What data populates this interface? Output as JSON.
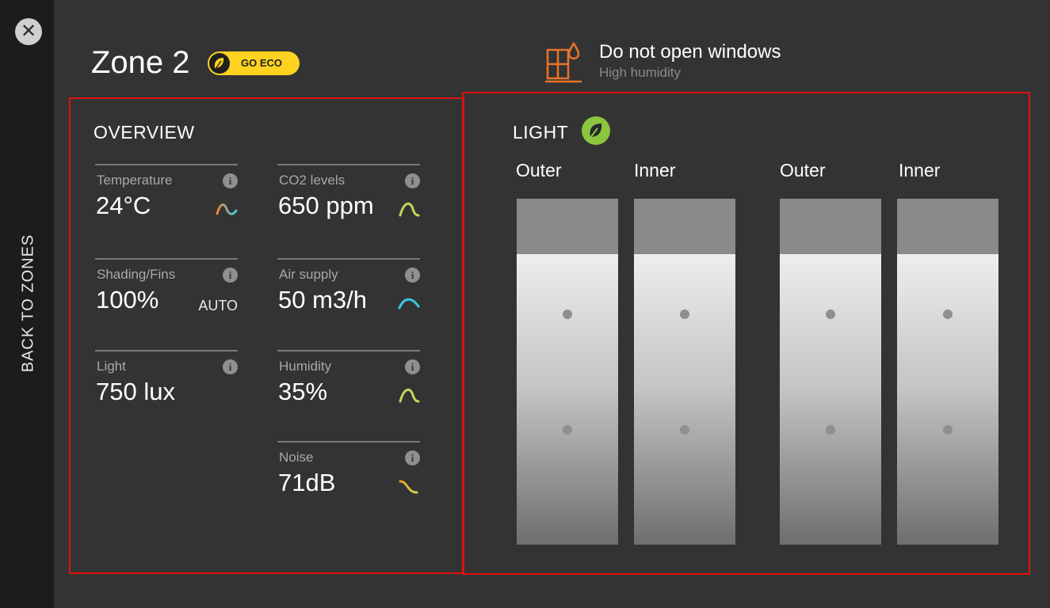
{
  "nav": {
    "back_label": "BACK TO ZONES",
    "close_glyph": "✕"
  },
  "zone": {
    "title": "Zone 2",
    "eco_button_label": "GO ECO"
  },
  "alert": {
    "title": "Do not open windows",
    "subtitle": "High humidity"
  },
  "colors": {
    "accent_yellow": "#ffd21f",
    "eco_green": "#8cc63f",
    "alert_orange": "#e8742a",
    "panel_border": "#e01010"
  },
  "overview": {
    "title": "OVERVIEW",
    "metrics": [
      {
        "label": "Temperature",
        "value": "24°C",
        "trend_icon": "temperature-trend-icon"
      },
      {
        "label": "CO2 levels",
        "value": "650 ppm",
        "trend_icon": "co2-trend-icon"
      },
      {
        "label": "Shading/Fins",
        "value": "100%",
        "mode": "AUTO"
      },
      {
        "label": "Air supply",
        "value": "50 m3/h",
        "trend_icon": "air-trend-icon"
      },
      {
        "label": "Light",
        "value": "750 lux"
      },
      {
        "label": "Humidity",
        "value": "35%",
        "trend_icon": "humidity-trend-icon"
      },
      {
        "label": "Noise",
        "value": "71dB",
        "trend_icon": "noise-trend-icon"
      }
    ]
  },
  "light": {
    "title": "LIGHT",
    "columns": [
      {
        "label": "Outer",
        "shade_fraction": 0.16
      },
      {
        "label": "Inner",
        "shade_fraction": 0.16
      },
      {
        "label": "Outer",
        "shade_fraction": 0.16
      },
      {
        "label": "Inner",
        "shade_fraction": 0.16
      }
    ]
  }
}
